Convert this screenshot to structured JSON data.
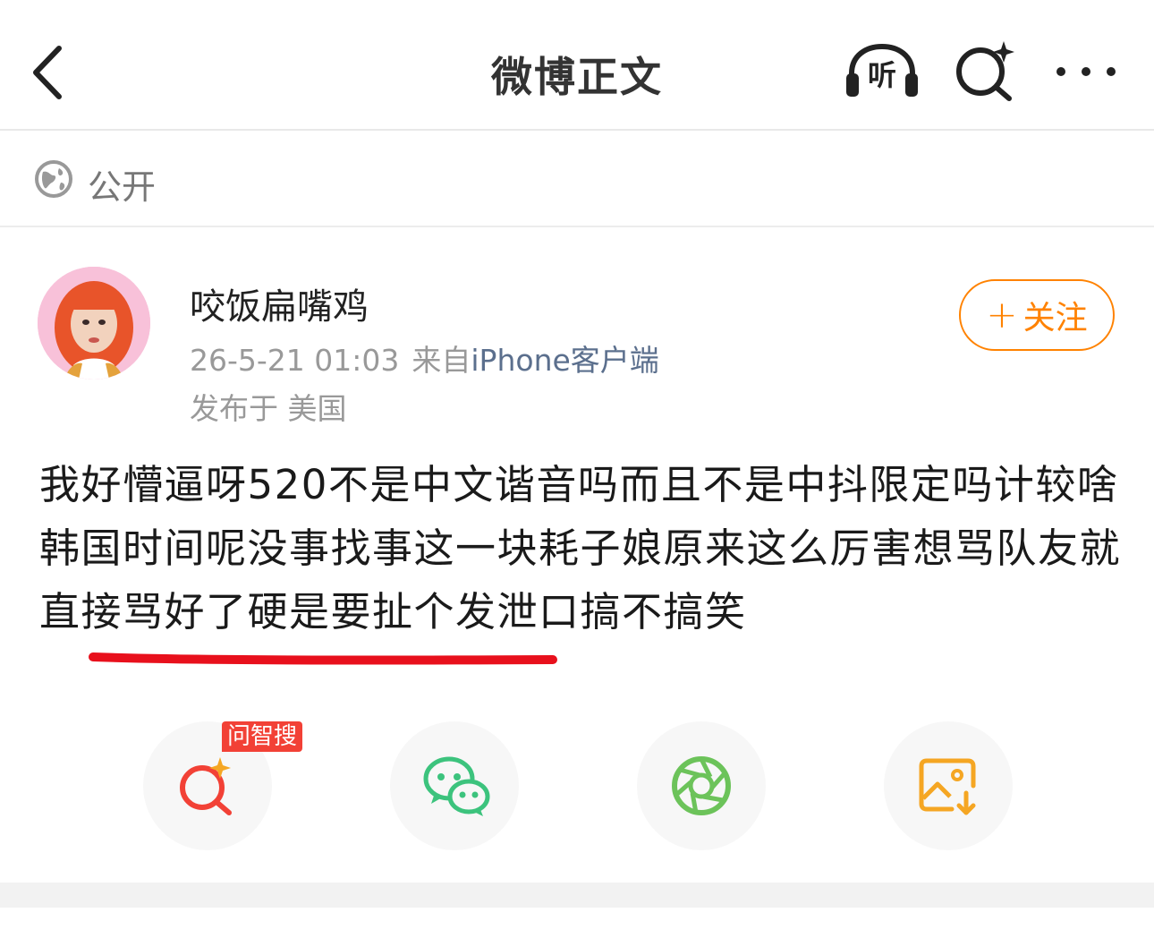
{
  "header": {
    "title": "微博正文",
    "listen_label": "听"
  },
  "visibility": {
    "label": "公开"
  },
  "post": {
    "username": "咬饭扁嘴鸡",
    "timestamp": "26-5-21 01:03",
    "source_prefix": "来自",
    "source_client": "iPhone客户端",
    "location": "发布于 美国",
    "follow_label": "关注",
    "text": "我好懵逼呀520不是中文谐音吗而且不是中抖限定吗计较啥韩国时间呢没事找事这一块耗子娘原来这么厉害想骂队友就直接骂好了硬是要扯个发泄口搞不搞笑"
  },
  "share": {
    "ai_badge": "问智搜",
    "items": [
      "ai-search",
      "wechat",
      "moments",
      "save-image"
    ]
  },
  "colors": {
    "accent_orange": "#ff8200",
    "link_blue": "#5b6f8d",
    "underline_red": "#e8101c",
    "wechat_green": "#3cc37d",
    "moments_green": "#6cc35a",
    "save_orange": "#f5a623",
    "ai_red": "#f24136"
  }
}
